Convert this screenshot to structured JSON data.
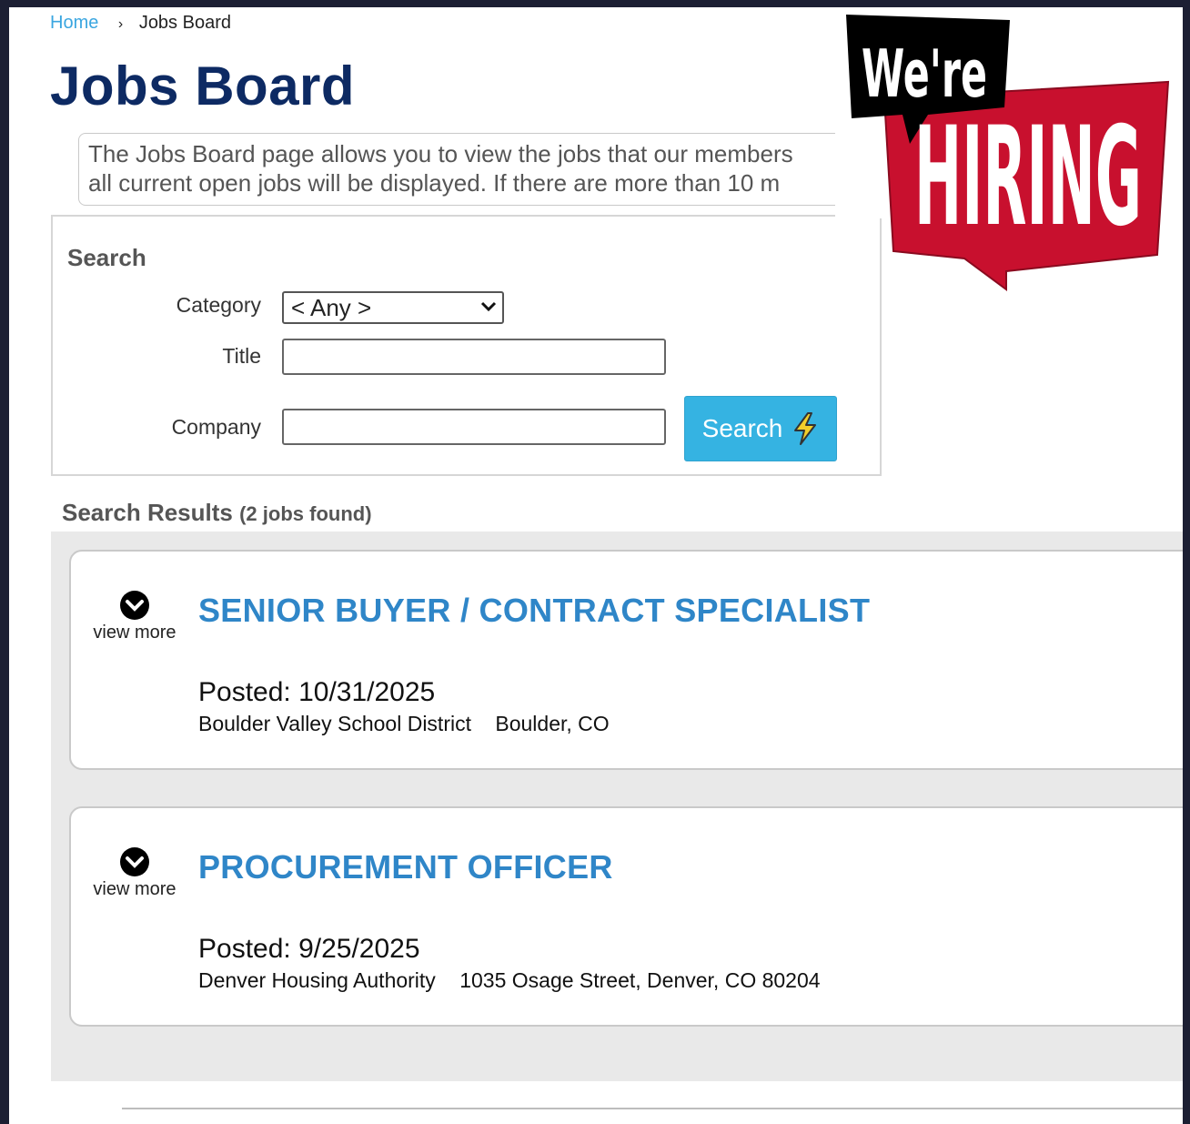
{
  "breadcrumb": {
    "home": "Home",
    "separator": "›",
    "current": "Jobs Board"
  },
  "page_title": "Jobs Board",
  "intro": {
    "line1": "The Jobs Board page allows you to view the jobs that our members",
    "line2": "all current open jobs will be displayed.  If there are more than 10 m"
  },
  "search": {
    "heading": "Search",
    "category_label": "Category",
    "category_value": "< Any >",
    "title_label": "Title",
    "title_value": "",
    "company_label": "Company",
    "company_value": "",
    "button_label": "Search"
  },
  "results": {
    "heading": "Search Results",
    "count": "(2 jobs found)",
    "jobs": [
      {
        "view_more": "view more",
        "title": "SENIOR BUYER / CONTRACT SPECIALIST",
        "posted": "Posted: 10/31/2025",
        "organization": "Boulder Valley School District",
        "location": "Boulder, CO"
      },
      {
        "view_more": "view more",
        "title": "PROCUREMENT OFFICER",
        "posted": "Posted: 9/25/2025",
        "organization": "Denver Housing Authority",
        "location": "1035 Osage Street, Denver, CO 80204"
      }
    ]
  },
  "badge": {
    "line1": "We're",
    "line2": "HIRING"
  },
  "colors": {
    "title_navy": "#0d2a63",
    "link_blue": "#3aa6e0",
    "job_title_blue": "#2f86c8",
    "search_button": "#35b3e2",
    "badge_red": "#c8102e",
    "badge_black": "#000000"
  },
  "icons": {
    "select": "chevron-down-icon",
    "search_button": "lightning-icon",
    "view_more": "chevron-circle-down-icon"
  }
}
